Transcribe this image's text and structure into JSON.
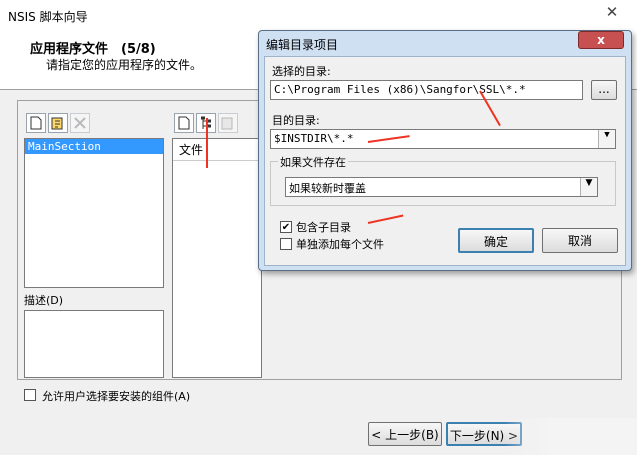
{
  "window": {
    "title": "NSIS 脚本向导",
    "close_glyph": "✕"
  },
  "header": {
    "title": "应用程序文件　(5/8)",
    "description": "请指定您的应用程序的文件。"
  },
  "left_panel": {
    "selected_item": "MainSection",
    "description_label": "描述(D)"
  },
  "files_panel": {
    "column_header": "文件"
  },
  "bottom": {
    "checkbox_label": "允许用户选择要安装的组件(A)",
    "back_button": "< 上一步(B)",
    "next_button": "下一步(N) >"
  },
  "dialog": {
    "title": "编辑目录项目",
    "close_glyph": "x",
    "source_label": "选择的目录:",
    "source_value": "C:\\Program Files (x86)\\Sangfor\\SSL\\*.*",
    "browse_label": "...",
    "dest_label": "目的目录:",
    "dest_value": "$INSTDIR\\*.*",
    "if_exists_label": "如果文件存在",
    "if_exists_value": "如果较新时覆盖",
    "include_subdirs_label": "包含子目录",
    "include_subdirs_checked": true,
    "add_each_label": "单独添加每个文件",
    "add_each_checked": false,
    "ok_label": "确定",
    "cancel_label": "取消"
  },
  "colors": {
    "annotation_red": "#e32222",
    "selection_blue": "#3399ff"
  }
}
